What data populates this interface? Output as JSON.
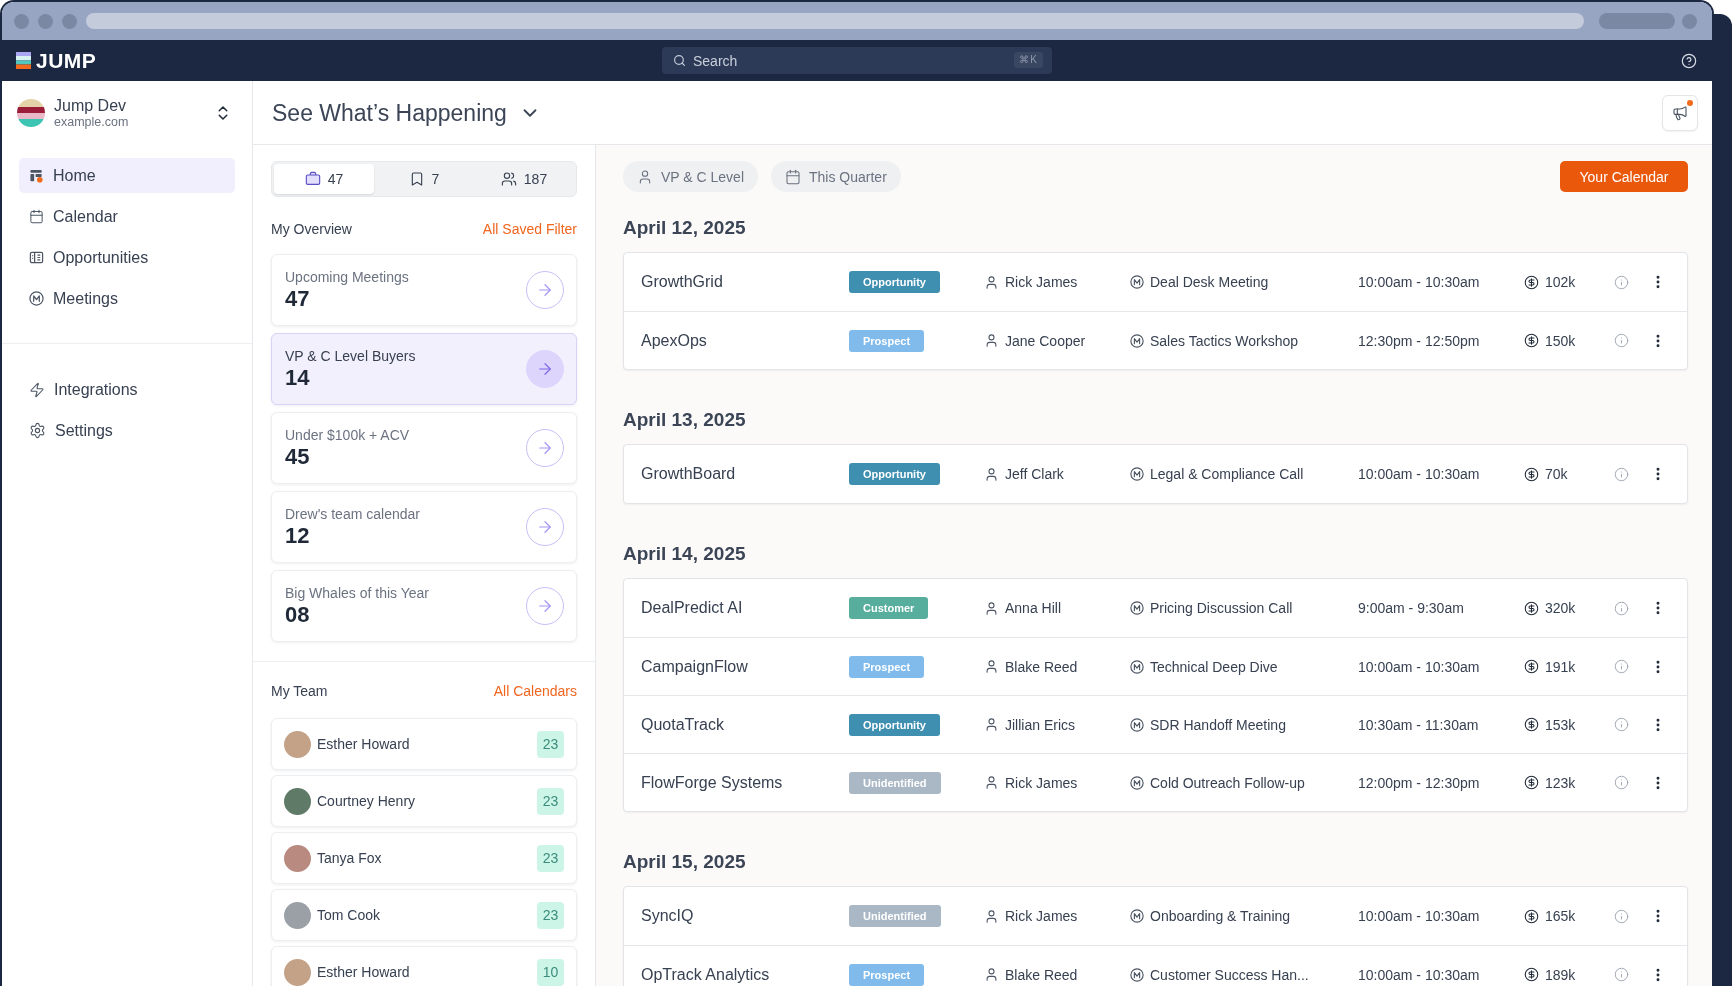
{
  "header": {
    "logo": "JUMP",
    "search": {
      "placeholder": "Search",
      "shortcut": "⌘K"
    }
  },
  "workspace": {
    "name": "Jump Dev",
    "domain": "example.com"
  },
  "sidebar": {
    "items": [
      {
        "label": "Home",
        "selected": true
      },
      {
        "label": "Calendar",
        "selected": false
      },
      {
        "label": "Opportunities",
        "selected": false
      },
      {
        "label": "Meetings",
        "selected": false
      }
    ],
    "footer_items": [
      {
        "label": "Integrations",
        "selected": false
      },
      {
        "label": "Settings",
        "selected": false
      }
    ]
  },
  "page": {
    "title": "See What’s Happening",
    "announcements_unread": true
  },
  "tabs": [
    {
      "count": "47",
      "selected": true
    },
    {
      "count": "7",
      "selected": false
    },
    {
      "count": "187",
      "selected": false
    }
  ],
  "overview": {
    "title": "My Overview",
    "link": "All Saved Filter",
    "cards": [
      {
        "label": "Upcoming Meetings",
        "value": "47",
        "selected": false
      },
      {
        "label": "VP & C Level Buyers",
        "value": "14",
        "selected": true
      },
      {
        "label": "Under $100k + ACV",
        "value": "45",
        "selected": false
      },
      {
        "label": "Drew's team calendar",
        "value": "12",
        "selected": false
      },
      {
        "label": "Big Whales of this Year",
        "value": "08",
        "selected": false
      }
    ]
  },
  "team": {
    "title": "My Team",
    "link": "All Calendars",
    "members": [
      {
        "name": "Esther Howard",
        "count": "23"
      },
      {
        "name": "Courtney Henry",
        "count": "23"
      },
      {
        "name": "Tanya Fox",
        "count": "23"
      },
      {
        "name": "Tom Cook",
        "count": "23"
      },
      {
        "name": "Esther Howard",
        "count": "10"
      }
    ]
  },
  "filters": [
    {
      "label": "VP & C Level"
    },
    {
      "label": "This Quarter"
    }
  ],
  "calendar_button": "Your Calendar",
  "sections": [
    {
      "date": "April 12, 2025",
      "rows": [
        {
          "company": "GrowthGrid",
          "tag": {
            "label": "Opportunity",
            "color": "#3f8fb1"
          },
          "owner": "Rick James",
          "meeting": "Deal Desk Meeting",
          "time": "10:00am - 10:30am",
          "amount": "102k"
        },
        {
          "company": "ApexOps",
          "tag": {
            "label": "Prospect",
            "color": "#80bbec"
          },
          "owner": "Jane Cooper",
          "meeting": "Sales Tactics Workshop",
          "time": "12:30pm - 12:50pm",
          "amount": "150k"
        }
      ]
    },
    {
      "date": "April 13, 2025",
      "rows": [
        {
          "company": "GrowthBoard",
          "tag": {
            "label": "Opportunity",
            "color": "#3f8fb1"
          },
          "owner": "Jeff Clark",
          "meeting": "Legal & Compliance Call",
          "time": "10:00am - 10:30am",
          "amount": "70k"
        }
      ]
    },
    {
      "date": "April 14, 2025",
      "rows": [
        {
          "company": "DealPredict AI",
          "tag": {
            "label": "Customer",
            "color": "#57ae9d"
          },
          "owner": "Anna Hill",
          "meeting": "Pricing Discussion Call",
          "time": "9:00am - 9:30am",
          "amount": "320k"
        },
        {
          "company": "CampaignFlow",
          "tag": {
            "label": "Prospect",
            "color": "#80bbec"
          },
          "owner": "Blake Reed",
          "meeting": "Technical Deep Dive",
          "time": "10:00am - 10:30am",
          "amount": "191k"
        },
        {
          "company": "QuotaTrack",
          "tag": {
            "label": "Opportunity",
            "color": "#3f8fb1"
          },
          "owner": "Jillian Erics",
          "meeting": "SDR Handoff Meeting",
          "time": "10:30am - 11:30am",
          "amount": "153k"
        },
        {
          "company": "FlowForge Systems",
          "tag": {
            "label": "Unidentified",
            "color": "#aab8c5"
          },
          "owner": "Rick James",
          "meeting": "Cold Outreach Follow-up",
          "time": "12:00pm - 12:30pm",
          "amount": "123k"
        }
      ]
    },
    {
      "date": "April 15, 2025",
      "rows": [
        {
          "company": "SyncIQ",
          "tag": {
            "label": "Unidentified",
            "color": "#aab8c5"
          },
          "owner": "Rick James",
          "meeting": "Onboarding & Training",
          "time": "10:00am - 10:30am",
          "amount": "165k"
        },
        {
          "company": "OpTrack Analytics",
          "tag": {
            "label": "Prospect",
            "color": "#80bbec"
          },
          "owner": "Blake Reed",
          "meeting": "Customer Success Han...",
          "time": "10:00am - 10:30am",
          "amount": "189k"
        }
      ]
    }
  ]
}
